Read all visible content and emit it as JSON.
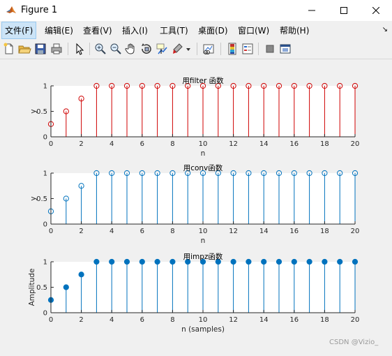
{
  "window": {
    "title": "Figure 1"
  },
  "menu": [
    "文件(F)",
    "编辑(E)",
    "查看(V)",
    "插入(I)",
    "工具(T)",
    "桌面(D)",
    "窗口(W)",
    "帮助(H)"
  ],
  "toolbar_icons": [
    "new-figure-icon",
    "open-file-icon",
    "save-icon",
    "print-icon",
    "pointer-icon",
    "zoom-in-icon",
    "zoom-out-icon",
    "pan-icon",
    "rotate-3d-icon",
    "data-cursor-icon",
    "brush-icon",
    "link-plot-icon",
    "colorbar-icon",
    "legend-icon",
    "hide-plot-tools-icon",
    "show-plot-tools-icon"
  ],
  "chart_data": [
    {
      "type": "stem",
      "title": "用filter 函数",
      "xlabel": "n",
      "ylabel": "y",
      "color": "#d00000",
      "filled": false,
      "x": [
        0,
        1,
        2,
        3,
        4,
        5,
        6,
        7,
        8,
        9,
        10,
        11,
        12,
        13,
        14,
        15,
        16,
        17,
        18,
        19,
        20
      ],
      "values": [
        0.25,
        0.5,
        0.75,
        1,
        1,
        1,
        1,
        1,
        1,
        1,
        1,
        1,
        1,
        1,
        1,
        1,
        1,
        1,
        1,
        1,
        1
      ],
      "xlim": [
        0,
        20
      ],
      "ylim": [
        0,
        1
      ],
      "xticks": [
        "0",
        "2",
        "4",
        "6",
        "8",
        "10",
        "12",
        "14",
        "16",
        "18",
        "20"
      ],
      "yticks": [
        "0",
        "0.5",
        "1"
      ]
    },
    {
      "type": "stem",
      "title": "用conv函数",
      "xlabel": "n",
      "ylabel": "y",
      "color": "#0072bd",
      "filled": false,
      "x": [
        0,
        1,
        2,
        3,
        4,
        5,
        6,
        7,
        8,
        9,
        10,
        11,
        12,
        13,
        14,
        15,
        16,
        17,
        18,
        19,
        20
      ],
      "values": [
        0.25,
        0.5,
        0.75,
        1,
        1,
        1,
        1,
        1,
        1,
        1,
        1,
        1,
        1,
        1,
        1,
        1,
        1,
        1,
        1,
        1,
        1
      ],
      "xlim": [
        0,
        20
      ],
      "ylim": [
        0,
        1
      ],
      "xticks": [
        "0",
        "2",
        "4",
        "6",
        "8",
        "10",
        "12",
        "14",
        "16",
        "18",
        "20"
      ],
      "yticks": [
        "0",
        "0.5",
        "1"
      ]
    },
    {
      "type": "stem",
      "title": "用impz函数",
      "xlabel": "n (samples)",
      "ylabel": "Amplitude",
      "color": "#0072bd",
      "filled": true,
      "x": [
        0,
        1,
        2,
        3,
        4,
        5,
        6,
        7,
        8,
        9,
        10,
        11,
        12,
        13,
        14,
        15,
        16,
        17,
        18,
        19,
        20
      ],
      "values": [
        0.25,
        0.5,
        0.75,
        1,
        1,
        1,
        1,
        1,
        1,
        1,
        1,
        1,
        1,
        1,
        1,
        1,
        1,
        1,
        1,
        1,
        1
      ],
      "xlim": [
        0,
        20
      ],
      "ylim": [
        0,
        1
      ],
      "xticks": [
        "0",
        "2",
        "4",
        "6",
        "8",
        "10",
        "12",
        "14",
        "16",
        "18",
        "20"
      ],
      "yticks": [
        "0",
        "0.5",
        "1"
      ]
    }
  ],
  "watermark": "CSDN @Vizio_"
}
